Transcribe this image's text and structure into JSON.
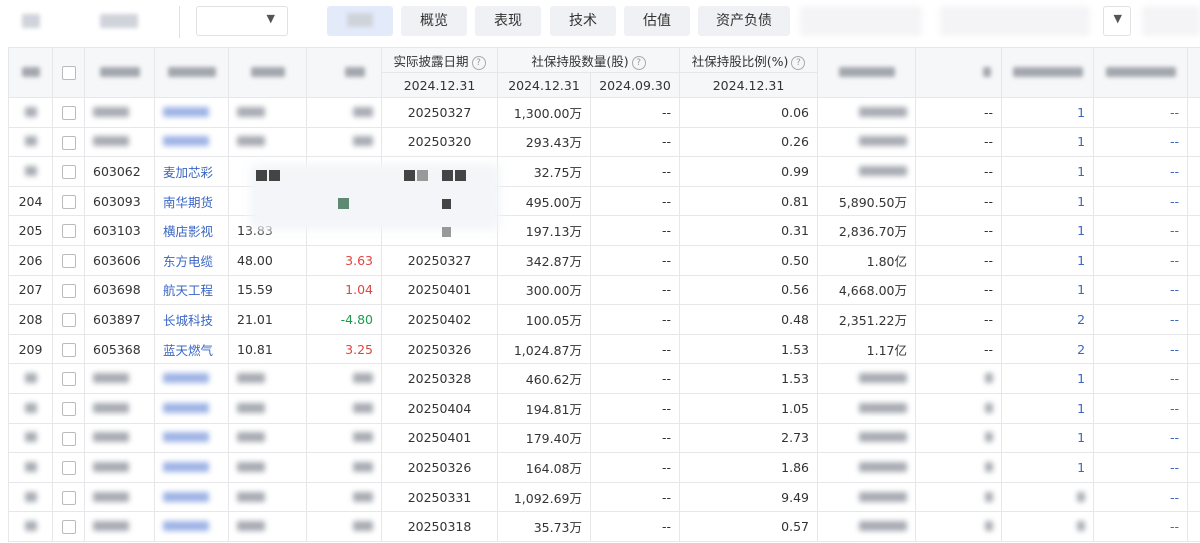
{
  "toolbar": {
    "tabs": [
      "概览",
      "表现",
      "技术",
      "估值",
      "资产负债"
    ],
    "select_caret": "▼"
  },
  "header": {
    "disclosure_date": "实际披露日期",
    "disclosure_sub": "2024.12.31",
    "holding_qty": "社保持股数量(股)",
    "holding_qty_sub1": "2024.12.31",
    "holding_qty_sub2": "2024.09.30",
    "holding_ratio": "社保持股比例(%)",
    "holding_ratio_sub": "2024.12.31",
    "help_glyph": "?"
  },
  "rows": [
    {
      "idx": "",
      "code": "",
      "name": "",
      "price": "",
      "chg": "",
      "date": "20250327",
      "qty": "1,300.00万",
      "qty_prev": "--",
      "ratio": "0.06",
      "mktval": "",
      "c10": "--",
      "c11": "1",
      "c12": "--"
    },
    {
      "idx": "",
      "code": "",
      "name": "",
      "price": "",
      "chg": "",
      "date": "20250320",
      "qty": "293.43万",
      "qty_prev": "--",
      "ratio": "0.26",
      "mktval": "",
      "c10": "--",
      "c11": "1",
      "c12": "--"
    },
    {
      "idx": "",
      "code": "603062",
      "name": "麦加芯彩",
      "price": "",
      "chg": "",
      "date": "",
      "qty": "32.75万",
      "qty_prev": "--",
      "ratio": "0.99",
      "mktval": "",
      "c10": "--",
      "c11": "1",
      "c12": "--"
    },
    {
      "idx": "204",
      "code": "603093",
      "name": "南华期货",
      "price": "",
      "chg": "",
      "date": "",
      "qty": "495.00万",
      "qty_prev": "--",
      "ratio": "0.81",
      "mktval": "5,890.50万",
      "c10": "--",
      "c11": "1",
      "c12": "--"
    },
    {
      "idx": "205",
      "code": "603103",
      "name": "横店影视",
      "price": "13.83",
      "chg": "",
      "date": "",
      "qty": "197.13万",
      "qty_prev": "--",
      "ratio": "0.31",
      "mktval": "2,836.70万",
      "c10": "--",
      "c11": "1",
      "c12": "--"
    },
    {
      "idx": "206",
      "code": "603606",
      "name": "东方电缆",
      "price": "48.00",
      "chg": "3.63",
      "date": "20250327",
      "qty": "342.87万",
      "qty_prev": "--",
      "ratio": "0.50",
      "mktval": "1.80亿",
      "c10": "--",
      "c11": "1",
      "c12": "--"
    },
    {
      "idx": "207",
      "code": "603698",
      "name": "航天工程",
      "price": "15.59",
      "chg": "1.04",
      "date": "20250401",
      "qty": "300.00万",
      "qty_prev": "--",
      "ratio": "0.56",
      "mktval": "4,668.00万",
      "c10": "--",
      "c11": "1",
      "c12": "--"
    },
    {
      "idx": "208",
      "code": "603897",
      "name": "长城科技",
      "price": "21.01",
      "chg": "-4.80",
      "date": "20250402",
      "qty": "100.05万",
      "qty_prev": "--",
      "ratio": "0.48",
      "mktval": "2,351.22万",
      "c10": "--",
      "c11": "2",
      "c12": "--"
    },
    {
      "idx": "209",
      "code": "605368",
      "name": "蓝天燃气",
      "price": "10.81",
      "chg": "3.25",
      "date": "20250326",
      "qty": "1,024.87万",
      "qty_prev": "--",
      "ratio": "1.53",
      "mktval": "1.17亿",
      "c10": "--",
      "c11": "2",
      "c12": "--"
    },
    {
      "idx": "",
      "code": "",
      "name": "",
      "price": "",
      "chg": "",
      "date": "20250328",
      "qty": "460.62万",
      "qty_prev": "--",
      "ratio": "1.53",
      "mktval": "",
      "c10": "",
      "c11": "1",
      "c12": "--"
    },
    {
      "idx": "",
      "code": "",
      "name": "",
      "price": "",
      "chg": "",
      "date": "20250404",
      "qty": "194.81万",
      "qty_prev": "--",
      "ratio": "1.05",
      "mktval": "",
      "c10": "",
      "c11": "1",
      "c12": "--"
    },
    {
      "idx": "",
      "code": "",
      "name": "",
      "price": "",
      "chg": "",
      "date": "20250401",
      "qty": "179.40万",
      "qty_prev": "--",
      "ratio": "2.73",
      "mktval": "",
      "c10": "",
      "c11": "1",
      "c12": "--"
    },
    {
      "idx": "",
      "code": "",
      "name": "",
      "price": "",
      "chg": "",
      "date": "20250326",
      "qty": "164.08万",
      "qty_prev": "--",
      "ratio": "1.86",
      "mktval": "",
      "c10": "",
      "c11": "1",
      "c12": "--"
    },
    {
      "idx": "",
      "code": "",
      "name": "",
      "price": "",
      "chg": "",
      "date": "20250331",
      "qty": "1,092.69万",
      "qty_prev": "--",
      "ratio": "9.49",
      "mktval": "",
      "c10": "",
      "c11": "",
      "c12": "--"
    },
    {
      "idx": "",
      "code": "",
      "name": "",
      "price": "",
      "chg": "",
      "date": "20250318",
      "qty": "35.73万",
      "qty_prev": "--",
      "ratio": "0.57",
      "mktval": "",
      "c10": "",
      "c11": "",
      "c12": "--"
    }
  ]
}
